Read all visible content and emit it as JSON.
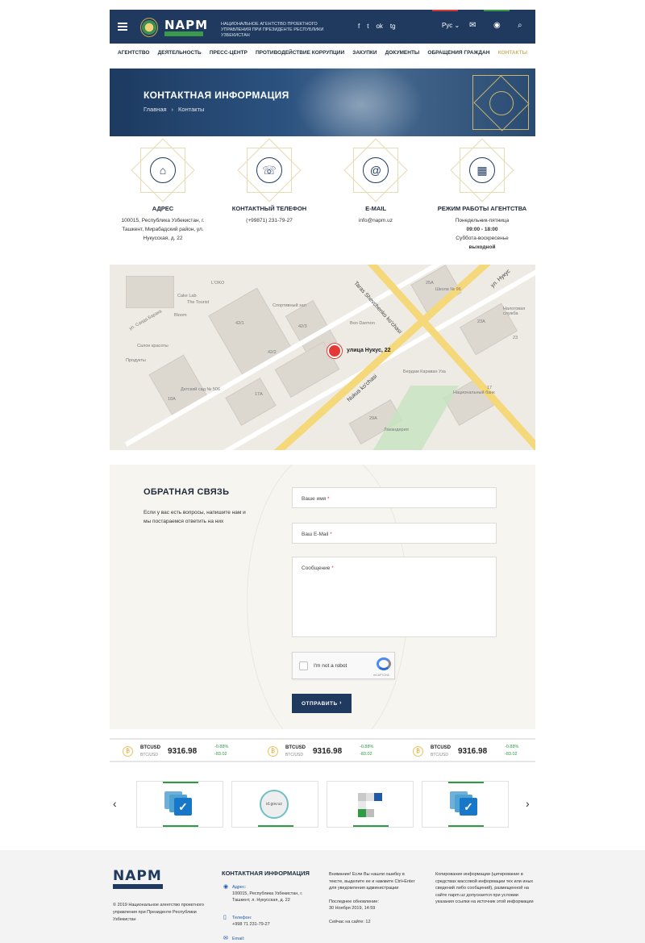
{
  "header": {
    "logo_text": "NAPM",
    "title": "Национальное агентство проектного управления при Президенте Республики Узбекистан",
    "socials": [
      "f",
      "t",
      "ok",
      "tg"
    ],
    "lang": "Рус ⌄",
    "icons": [
      "mail-icon",
      "eye-icon",
      "search-icon"
    ]
  },
  "nav": {
    "items": [
      {
        "label": "Агентство",
        "active": false
      },
      {
        "label": "Деятельность",
        "active": false
      },
      {
        "label": "Пресс-центр",
        "active": false
      },
      {
        "label": "Противодействие коррупции",
        "active": false
      },
      {
        "label": "Закупки",
        "active": false
      },
      {
        "label": "Документы",
        "active": false
      },
      {
        "label": "Обращения граждан",
        "active": false
      },
      {
        "label": "Контакты",
        "active": true
      }
    ]
  },
  "hero": {
    "title": "КОНТАКТНАЯ ИНФОРМАЦИЯ",
    "crumb_home": "Главная",
    "crumb_sep": "›",
    "crumb_current": "Контакты"
  },
  "contacts": [
    {
      "icon": "home-icon",
      "glyph": "⌂",
      "title": "Адрес",
      "text": "100015, Республика Узбекистан, г. Ташкент, Мирабадский район, ул. Нукусская, д. 22"
    },
    {
      "icon": "phone-icon",
      "glyph": "☏",
      "title": "Контактный телефон",
      "text": "(+99871) 231-79-27"
    },
    {
      "icon": "email-icon",
      "glyph": "@",
      "title": "E-mail",
      "text": "info@napm.uz"
    },
    {
      "icon": "calendar-icon",
      "glyph": "▦",
      "title": "Режим работы агентства",
      "line1": "Понедельник-пятница",
      "line2": "09:00 - 18:00",
      "line3": "Суббота-воскресенье",
      "line4": "выходной"
    }
  ],
  "map": {
    "pin_label": "улица Нукус, 22",
    "labels": [
      "Cake Lab",
      "L'OKO",
      "Спортивный зал",
      "ул. Саида Барака",
      "The Tourist",
      "Bloom",
      "Салон красоты",
      "Детский сад № 506",
      "Продукты",
      "Bon Darmon",
      "Taras Shevchenko ko'chasi",
      "Nukus ko'chasi",
      "ул. Нукус",
      "Школа № 96",
      "Налоговая служба",
      "Бердам Караван Уза",
      "Национальный банк",
      "Лакандерия"
    ],
    "numbers": [
      "42/1",
      "42/2",
      "42/3",
      "18A",
      "17A",
      "29A",
      "25A",
      "23A",
      "23",
      "17"
    ]
  },
  "feedback": {
    "title": "ОБРАТНАЯ СВЯЗЬ",
    "text": "Если у вас есть вопросы, напишите нам и мы постараемся ответить на них",
    "name_placeholder": "Ваше имя",
    "email_placeholder": "Ваш E-Mail",
    "message_placeholder": "Сообщение",
    "required_mark": "*",
    "captcha_label": "I'm not a robot",
    "captcha_brand": "reCAPTCHA",
    "submit_label": "ОТПРАВИТЬ",
    "submit_arrow": "›"
  },
  "ticker": [
    {
      "symbol": "BTCUSD",
      "sub": "BTC/USD",
      "price": "9316.98",
      "change_pct": "-0.88%",
      "change_abs": "-83.02"
    },
    {
      "symbol": "BTCUSD",
      "sub": "BTC/USD",
      "price": "9316.98",
      "change_pct": "-0.88%",
      "change_abs": "-83.02"
    },
    {
      "symbol": "BTCUSD",
      "sub": "BTC/USD",
      "price": "9316.98",
      "change_pct": "-0.88%",
      "change_abs": "-83.02"
    }
  ],
  "partners": {
    "prev": "‹",
    "next": "›",
    "items": [
      {
        "type": "check-logo",
        "mark": "✓"
      },
      {
        "type": "circle-logo",
        "text": "id.gov.uz"
      },
      {
        "type": "squares-logo"
      },
      {
        "type": "check-logo",
        "mark": "✓"
      }
    ]
  },
  "footer": {
    "logo_text": "NAPM",
    "copyright": "© 2019 Национальное агентство проектного управления при Президенте Республики Узбекистан",
    "contact_title": "КОНТАКТНАЯ ИНФОРМАЦИЯ",
    "address_label": "Адрес:",
    "address": "100015, Республика Узбекистан, г. Ташкент, л. Нукусская, д. 22",
    "phone_label": "Телефон:",
    "phone": "+998 71 231-79-27",
    "email_label": "Email:",
    "notice": "Внимание! Если Вы нашли ошибку в тексте, выделите ее и нажмите Ctrl+Enter для уведомления администрации",
    "last_update_label": "Последнее обновление:",
    "last_update": "30 Ноября 2019, 14:59",
    "online": "Сейчас на сайте: 12",
    "copy_notice": "Копирование информации (цитирование в средствах массовой информации тех или иных сведений либо сообщений), размещенной на сайте napm.uz допускается при условии указания ссылки на источник этой информации"
  }
}
